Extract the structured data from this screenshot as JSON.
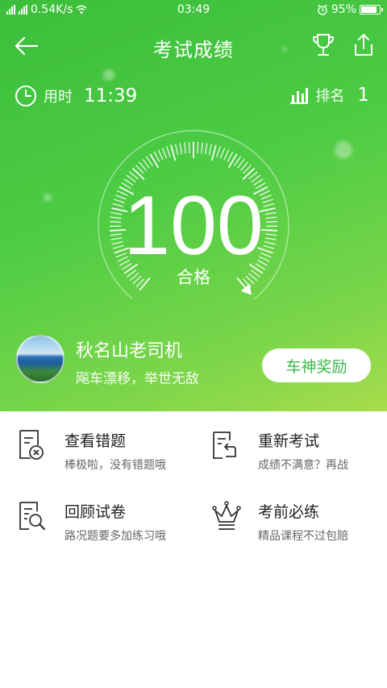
{
  "status_bar": {
    "speed": "0.54K/s",
    "time": "03:49",
    "battery": "95%",
    "battery_level": 0.95
  },
  "nav": {
    "title": "考试成绩",
    "back_icon": "arrow-left-icon",
    "trophy_icon": "trophy-icon",
    "share_icon": "share-icon"
  },
  "stats": {
    "time_label": "用时",
    "time_value": "11:39",
    "rank_label": "排名",
    "rank_value": "1"
  },
  "result": {
    "score": "100",
    "score_fraction": 1.0,
    "status": "合格"
  },
  "user": {
    "name": "秋名山老司机",
    "motto": "飚车漂移，举世无敌",
    "reward_button": "车神奖励"
  },
  "menu": [
    {
      "title": "查看错题",
      "desc": "棒极啦，没有错题哦",
      "icon": "wrong-questions-icon"
    },
    {
      "title": "重新考试",
      "desc": "成绩不满意？再战",
      "icon": "retake-exam-icon"
    },
    {
      "title": "回顾试卷",
      "desc": "路况题要多加练习哦",
      "icon": "review-paper-icon"
    },
    {
      "title": "考前必练",
      "desc": "精品课程不过包赔",
      "icon": "crown-icon"
    }
  ],
  "colors": {
    "primary_green": "#3cbe3c",
    "accent_green": "#3ab94a",
    "light_green": "#a8dc4c"
  }
}
